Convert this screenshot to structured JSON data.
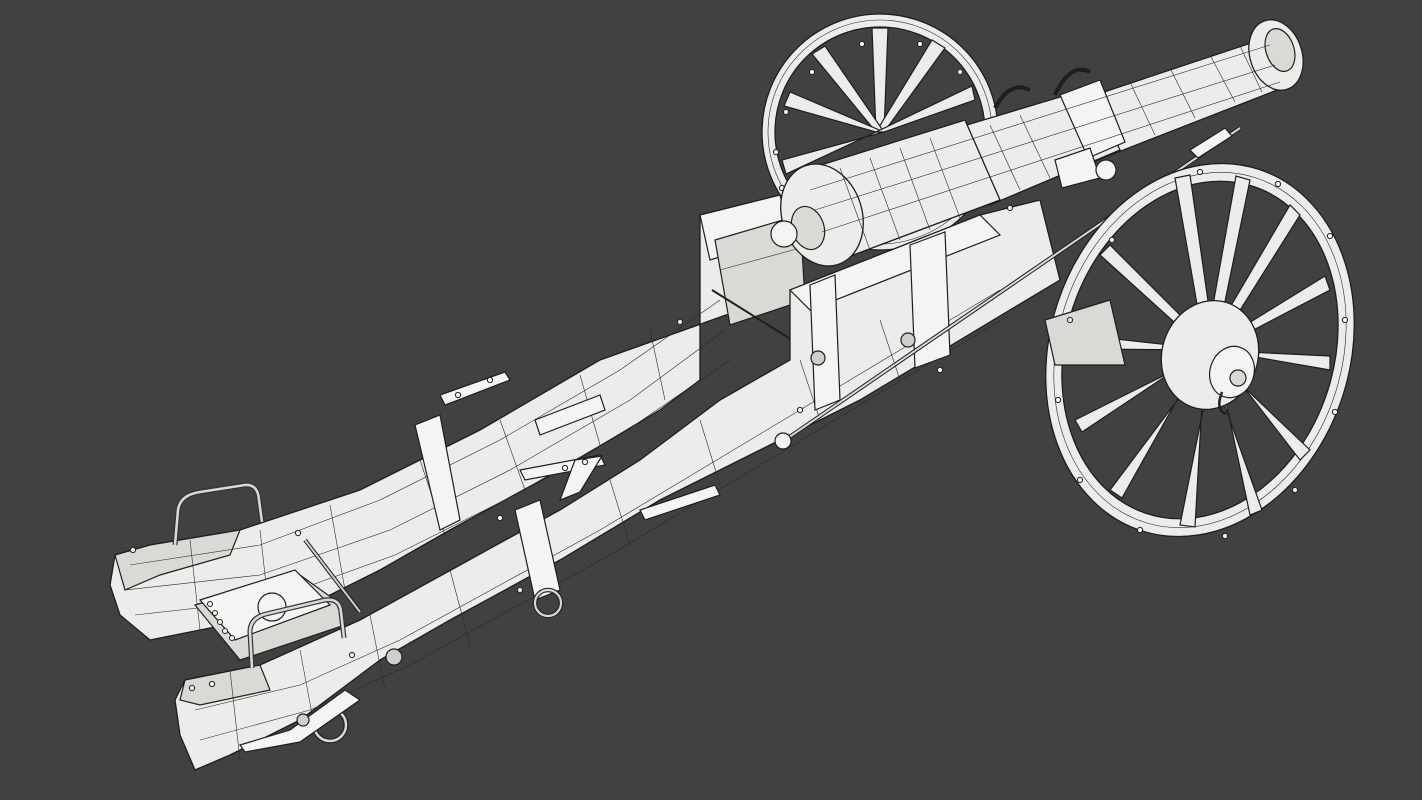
{
  "scene": {
    "background": "#414141",
    "model_fill": "#ecedea",
    "wire_color": "#2a2a2a",
    "subject": "cannon-wireframe-model"
  }
}
